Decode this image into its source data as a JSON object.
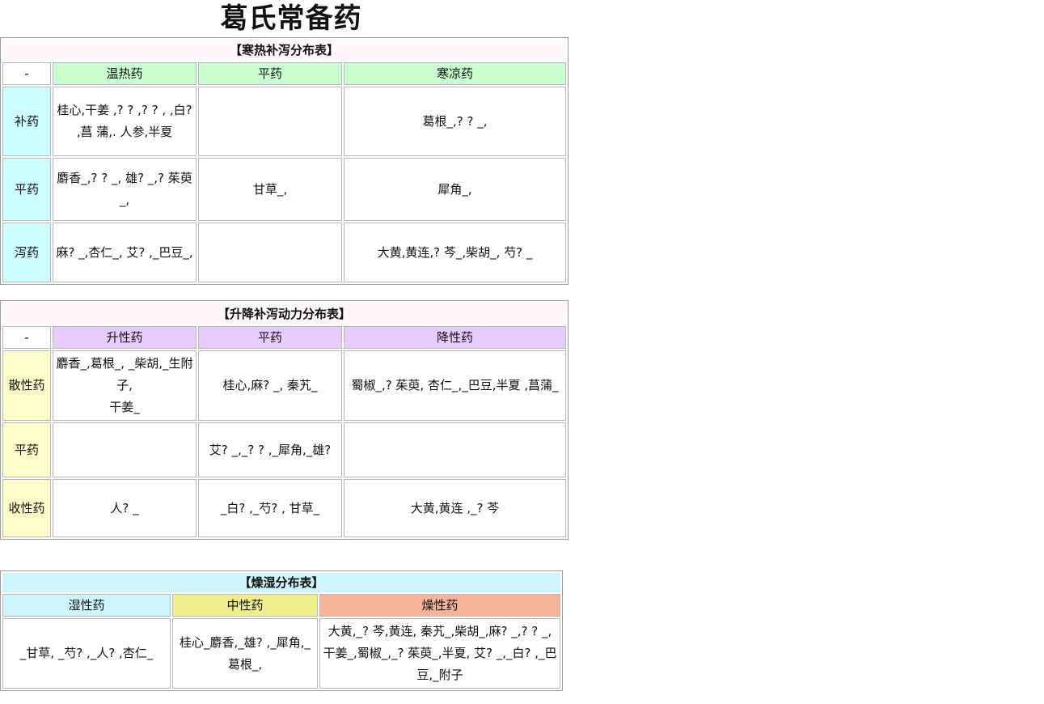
{
  "page_title": "葛氏常备药",
  "table1": {
    "caption": "【寒热补泻分布表】",
    "corner": "-",
    "columns": [
      "温热药",
      "平药",
      "寒凉药"
    ],
    "rows": [
      {
        "label": "补药",
        "cells": [
          "桂心,干姜 ,? ? ,? ? , ,白? ,菖 蒲,. 人参,半夏",
          "",
          "葛根_,? ? _,"
        ]
      },
      {
        "label": "平药",
        "cells": [
          "麝香_,? ? _, 雄? _,? 茱萸_,",
          "甘草_,",
          "犀角_,"
        ]
      },
      {
        "label": "泻药",
        "cells": [
          "麻? _,杏仁_, 艾? ,_巴豆_,",
          "",
          "大黄,黄连,? 芩_,柴胡_, 芍? _"
        ]
      }
    ]
  },
  "table2": {
    "caption": "【升降补泻动力分布表】",
    "corner": "-",
    "columns": [
      "升性药",
      "平药",
      "降性药"
    ],
    "rows": [
      {
        "label": "散性药",
        "cells": [
          "麝香_,葛根_, _柴胡,_生附子,",
          "桂心,麻? _, 秦艽_",
          "蜀椒_,? 茱萸, 杏仁_,_巴豆,半夏 ,菖蒲_"
        ],
        "extra_line": "干姜_"
      },
      {
        "label": "平药",
        "cells": [
          "",
          "艾? _,_? ? ,_犀角,_雄?",
          ""
        ]
      },
      {
        "label": "收性药",
        "cells": [
          "人? _",
          "_白? ,_芍? , 甘草_",
          "大黄,黄连 ,_? 芩"
        ]
      }
    ]
  },
  "table3": {
    "caption": "【燥湿分布表】",
    "columns": [
      "湿性药",
      "中性药",
      "燥性药"
    ],
    "cells": [
      "_甘草, _芍? ,_人? ,杏仁_",
      "桂心_麝香,_雄? ,_犀角,_葛根_,",
      "大黄,_? 芩,黄连, 秦艽_,柴胡_,麻? _,? ? _,干姜_,蜀椒_,_? 茱萸_,半夏, 艾? _,_白? ,_巴豆,_附子"
    ]
  }
}
